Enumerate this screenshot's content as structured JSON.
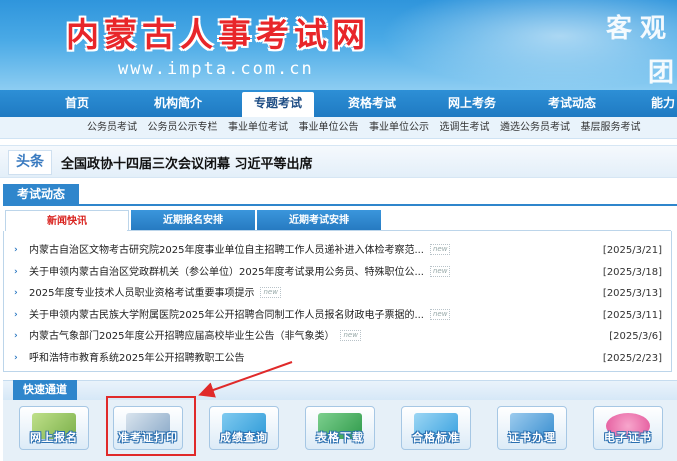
{
  "banner": {
    "site_title": "内蒙古人事考试网",
    "site_url": "www.impta.com.cn",
    "slogan_line1": "客观",
    "slogan_line2": "团"
  },
  "nav": {
    "items": [
      {
        "label": "首页"
      },
      {
        "label": "机构简介"
      },
      {
        "label": "专题考试"
      },
      {
        "label": "资格考试"
      },
      {
        "label": "网上考务"
      },
      {
        "label": "考试动态"
      },
      {
        "label": "能力"
      }
    ],
    "active": "专题考试"
  },
  "subnav": {
    "items": [
      "公务员考试",
      "公务员公示专栏",
      "事业单位考试",
      "事业单位公告",
      "事业单位公示",
      "选调生考试",
      "遴选公务员考试",
      "基层服务考试"
    ]
  },
  "headline": {
    "tag": "头条",
    "text": "全国政协十四届三次会议闭幕 习近平等出席"
  },
  "exam_dynamic": {
    "section_title": "考试动态",
    "tabs": [
      "新闻快讯",
      "近期报名安排",
      "近期考试安排"
    ],
    "active_tab": "新闻快讯",
    "news": [
      {
        "title": "内蒙古自治区文物考古研究院2025年度事业单位自主招聘工作人员递补进入体检考察范...",
        "badge": "new",
        "date": "[2025/3/21]"
      },
      {
        "title": "关于申领内蒙古自治区党政群机关（参公单位）2025年度考试录用公务员、特殊职位公...",
        "badge": "new",
        "date": "[2025/3/18]"
      },
      {
        "title": "2025年度专业技术人员职业资格考试重要事项提示",
        "badge": "new",
        "date": "[2025/3/13]"
      },
      {
        "title": "关于申领内蒙古民族大学附属医院2025年公开招聘合同制工作人员报名财政电子票据的...",
        "badge": "new",
        "date": "[2025/3/11]"
      },
      {
        "title": "内蒙古气象部门2025年度公开招聘应届高校毕业生公告（非气象类）",
        "badge": "new",
        "date": "[2025/3/6]"
      },
      {
        "title": "呼和浩特市教育系统2025年公开招聘教职工公告",
        "badge": "",
        "date": "[2025/2/23]"
      }
    ]
  },
  "quick_channel": {
    "title": "快速通道",
    "buttons": [
      {
        "label": "网上报名",
        "icon": "computer-icon",
        "color": "#8fc15a"
      },
      {
        "label": "准考证打印",
        "icon": "printer-icon",
        "color": "#8aa9c8"
      },
      {
        "label": "成绩查询",
        "icon": "chart-icon",
        "color": "#2f9bd8"
      },
      {
        "label": "表格下载",
        "icon": "excel-icon",
        "color": "#2f9a4a"
      },
      {
        "label": "合格标准",
        "icon": "certificate-icon",
        "color": "#3aa2e0"
      },
      {
        "label": "证书办理",
        "icon": "document-icon",
        "color": "#3a8fd0"
      },
      {
        "label": "电子证书",
        "icon": "badge-icon",
        "color": "#e4589c"
      }
    ],
    "highlighted": "准考证打印",
    "annotation_color": "#e02a2a"
  }
}
